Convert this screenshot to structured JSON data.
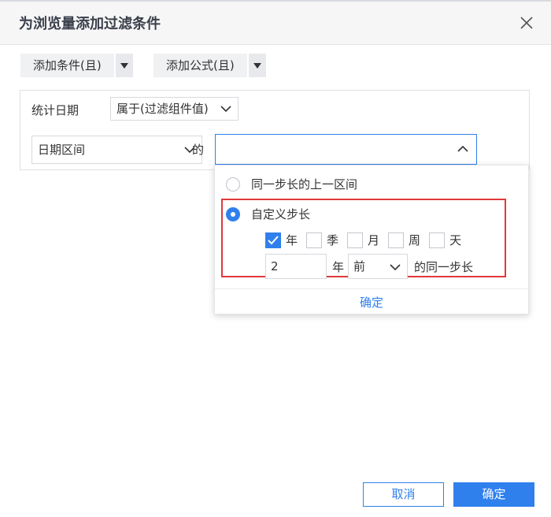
{
  "dialog": {
    "title": "为浏览量添加过滤条件",
    "close_icon": "close-icon"
  },
  "toolbar": {
    "add_condition_label": "添加条件(且)",
    "add_formula_label": "添加公式(且)"
  },
  "condition": {
    "field_label": "统计日期",
    "operator_value": "属于(过滤组件值)",
    "range_type_value": "日期区间",
    "connector_label": "的",
    "value_select_value": ""
  },
  "popup": {
    "option_previous_interval": "同一步长的上一区间",
    "option_custom_step": "自定义步长",
    "selected_option": "custom_step",
    "units": [
      {
        "label": "年",
        "checked": true
      },
      {
        "label": "季",
        "checked": false
      },
      {
        "label": "月",
        "checked": false
      },
      {
        "label": "周",
        "checked": false
      },
      {
        "label": "天",
        "checked": false
      }
    ],
    "step_value": "2",
    "step_unit_label": "年",
    "direction_value": "前",
    "suffix_label": "的同一步长",
    "confirm_label": "确定"
  },
  "footer": {
    "cancel_label": "取消",
    "ok_label": "确定"
  },
  "colors": {
    "accent": "#2f80ed",
    "highlight_border": "#e0393b"
  }
}
